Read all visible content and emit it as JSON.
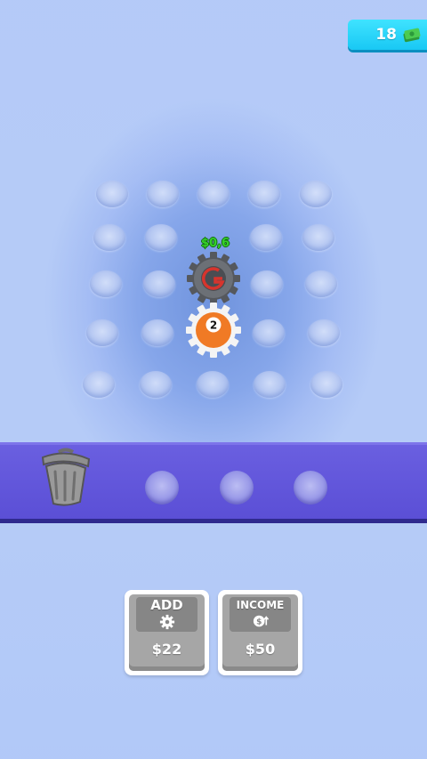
{
  "hud": {
    "money": "18",
    "money_icon": "cash-stack-icon",
    "accent_color": "#19c8f4"
  },
  "board": {
    "produced_income_label": "$0,6",
    "gears": [
      {
        "name": "gray-gear",
        "color": "#5a5d62",
        "center_color": "#d7342d"
      },
      {
        "name": "orange-gear",
        "color": "#f2f2f2",
        "center_color": "#f07a25",
        "level": "2"
      }
    ]
  },
  "conveyor": {
    "trash_icon": "trash-can-icon",
    "color": "#5b4fd6"
  },
  "buttons": {
    "add": {
      "title": "ADD",
      "icon": "gear-icon",
      "price": "$22"
    },
    "income": {
      "title": "INCOME",
      "icon": "coin-up-icon",
      "price": "$50"
    }
  }
}
